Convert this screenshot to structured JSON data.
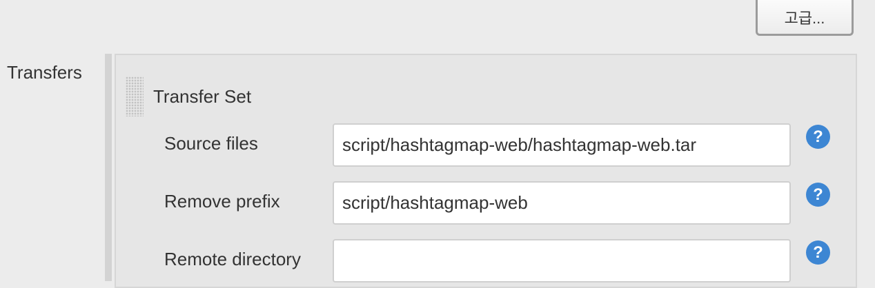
{
  "toolbar": {
    "advanced_label": "고급..."
  },
  "transfers": {
    "label": "Transfers",
    "set": {
      "title": "Transfer Set",
      "fields": [
        {
          "label": "Source files",
          "value": "script/hashtagmap-web/hashtagmap-web.tar"
        },
        {
          "label": "Remove prefix",
          "value": "script/hashtagmap-web"
        },
        {
          "label": "Remote directory",
          "value": ""
        }
      ],
      "help_glyph": "?"
    }
  },
  "colors": {
    "background": "#ececec",
    "panel": "#e6e6e6",
    "help_icon": "#3d86d3"
  },
  "icons": {
    "help": "help-question-icon",
    "drag": "drag-handle-icon"
  }
}
